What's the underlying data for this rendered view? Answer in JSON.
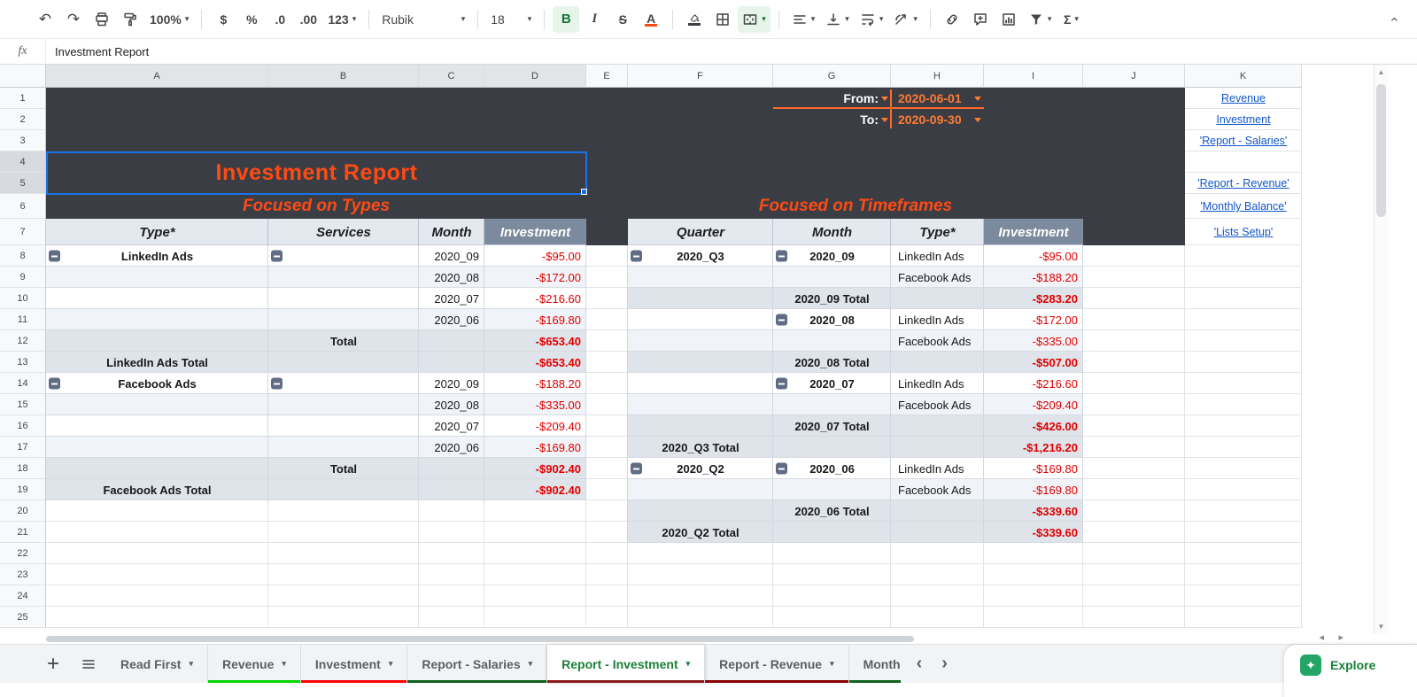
{
  "formula_bar": {
    "fx_label": "fx",
    "value": "Investment Report"
  },
  "toolbar": {
    "zoom": "100%",
    "font": "Rubik",
    "font_size": "18",
    "currency": "$",
    "percent": "%",
    "decimal_decrease": ".0",
    "decimal_increase": ".00",
    "number_format": "123",
    "bold": "B",
    "italic": "I",
    "strikethrough": "S",
    "text_color": "A",
    "functions": "Σ"
  },
  "icons": {
    "undo": "↶",
    "redo": "↷",
    "dropdown": "▾",
    "plus": "+",
    "prev": "‹",
    "next": "›",
    "explore_star": "✦",
    "scroll_up": "▲",
    "scroll_down": "▼",
    "scroll_left": "◂",
    "scroll_right": "▸"
  },
  "grid": {
    "column_letters": [
      "A",
      "B",
      "C",
      "D",
      "E",
      "F",
      "G",
      "H",
      "I",
      "J",
      "K"
    ],
    "row_numbers": [
      "1",
      "2",
      "3",
      "4",
      "5",
      "6",
      "7",
      "8",
      "9",
      "10",
      "11",
      "12",
      "13",
      "14",
      "15",
      "16",
      "17",
      "18",
      "19",
      "20",
      "21",
      "22",
      "23",
      "24",
      "25"
    ]
  },
  "filters": {
    "from_label": "From:",
    "from_value": "2020-06-01",
    "to_label": "To:",
    "to_value": "2020-09-30"
  },
  "title": "Investment Report",
  "left_table": {
    "heading": "Focused on Types",
    "columns": [
      "Type*",
      "Services",
      "Month",
      "Investment"
    ],
    "rows": [
      {
        "r": 8,
        "bg": "plain",
        "cells": [
          {
            "col": 0,
            "t": "LinkedIn Ads",
            "cls": "c b",
            "btn": true
          },
          {
            "col": 1,
            "t": "",
            "cls": "",
            "btn": true
          },
          {
            "col": 2,
            "t": "2020_09",
            "cls": "r"
          },
          {
            "col": 3,
            "t": "-$95.00",
            "cls": "r red"
          }
        ]
      },
      {
        "r": 9,
        "bg": "band",
        "cells": [
          {
            "col": 2,
            "t": "2020_08",
            "cls": "r"
          },
          {
            "col": 3,
            "t": "-$172.00",
            "cls": "r red"
          }
        ]
      },
      {
        "r": 10,
        "bg": "plain",
        "cells": [
          {
            "col": 2,
            "t": "2020_07",
            "cls": "r"
          },
          {
            "col": 3,
            "t": "-$216.60",
            "cls": "r red"
          }
        ]
      },
      {
        "r": 11,
        "bg": "band",
        "cells": [
          {
            "col": 2,
            "t": "2020_06",
            "cls": "r"
          },
          {
            "col": 3,
            "t": "-$169.80",
            "cls": "r red"
          }
        ]
      },
      {
        "r": 12,
        "bg": "total",
        "cells": [
          {
            "col": 1,
            "t": "Total",
            "cls": "c b"
          },
          {
            "col": 3,
            "t": "-$653.40",
            "cls": "r red b"
          }
        ]
      },
      {
        "r": 13,
        "bg": "total",
        "cells": [
          {
            "col": 0,
            "t": "LinkedIn Ads Total",
            "cls": "c b"
          },
          {
            "col": 3,
            "t": "-$653.40",
            "cls": "r red b"
          }
        ]
      },
      {
        "r": 14,
        "bg": "plain",
        "cells": [
          {
            "col": 0,
            "t": "Facebook Ads",
            "cls": "c b",
            "btn": true
          },
          {
            "col": 1,
            "t": "",
            "cls": "",
            "btn": true
          },
          {
            "col": 2,
            "t": "2020_09",
            "cls": "r"
          },
          {
            "col": 3,
            "t": "-$188.20",
            "cls": "r red"
          }
        ]
      },
      {
        "r": 15,
        "bg": "band",
        "cells": [
          {
            "col": 2,
            "t": "2020_08",
            "cls": "r"
          },
          {
            "col": 3,
            "t": "-$335.00",
            "cls": "r red"
          }
        ]
      },
      {
        "r": 16,
        "bg": "plain",
        "cells": [
          {
            "col": 2,
            "t": "2020_07",
            "cls": "r"
          },
          {
            "col": 3,
            "t": "-$209.40",
            "cls": "r red"
          }
        ]
      },
      {
        "r": 17,
        "bg": "band",
        "cells": [
          {
            "col": 2,
            "t": "2020_06",
            "cls": "r"
          },
          {
            "col": 3,
            "t": "-$169.80",
            "cls": "r red"
          }
        ]
      },
      {
        "r": 18,
        "bg": "total",
        "cells": [
          {
            "col": 1,
            "t": "Total",
            "cls": "c b"
          },
          {
            "col": 3,
            "t": "-$902.40",
            "cls": "r red b"
          }
        ]
      },
      {
        "r": 19,
        "bg": "total",
        "cells": [
          {
            "col": 0,
            "t": "Facebook Ads Total",
            "cls": "c b"
          },
          {
            "col": 3,
            "t": "-$902.40",
            "cls": "r red b"
          }
        ]
      }
    ]
  },
  "right_table": {
    "heading": "Focused on Timeframes",
    "columns": [
      "Quarter",
      "Month",
      "Type*",
      "Investment"
    ],
    "rows": [
      {
        "r": 8,
        "bg": "plain",
        "cells": [
          {
            "col": 0,
            "t": "2020_Q3",
            "cls": "c b",
            "btn": true
          },
          {
            "col": 1,
            "t": "2020_09",
            "cls": "c b",
            "btn": true
          },
          {
            "col": 2,
            "t": "LinkedIn Ads",
            "cls": "l"
          },
          {
            "col": 3,
            "t": "-$95.00",
            "cls": "r red"
          }
        ]
      },
      {
        "r": 9,
        "bg": "band",
        "cells": [
          {
            "col": 2,
            "t": "Facebook Ads",
            "cls": "l"
          },
          {
            "col": 3,
            "t": "-$188.20",
            "cls": "r red"
          }
        ]
      },
      {
        "r": 10,
        "bg": "total",
        "cells": [
          {
            "col": 1,
            "t": "2020_09 Total",
            "cls": "c b"
          },
          {
            "col": 3,
            "t": "-$283.20",
            "cls": "r red b"
          }
        ]
      },
      {
        "r": 11,
        "bg": "plain",
        "cells": [
          {
            "col": 1,
            "t": "2020_08",
            "cls": "c b",
            "btn": true
          },
          {
            "col": 2,
            "t": "LinkedIn Ads",
            "cls": "l"
          },
          {
            "col": 3,
            "t": "-$172.00",
            "cls": "r red"
          }
        ]
      },
      {
        "r": 12,
        "bg": "band",
        "cells": [
          {
            "col": 2,
            "t": "Facebook Ads",
            "cls": "l"
          },
          {
            "col": 3,
            "t": "-$335.00",
            "cls": "r red"
          }
        ]
      },
      {
        "r": 13,
        "bg": "total",
        "cells": [
          {
            "col": 1,
            "t": "2020_08 Total",
            "cls": "c b"
          },
          {
            "col": 3,
            "t": "-$507.00",
            "cls": "r red b"
          }
        ]
      },
      {
        "r": 14,
        "bg": "plain",
        "cells": [
          {
            "col": 1,
            "t": "2020_07",
            "cls": "c b",
            "btn": true
          },
          {
            "col": 2,
            "t": "LinkedIn Ads",
            "cls": "l"
          },
          {
            "col": 3,
            "t": "-$216.60",
            "cls": "r red"
          }
        ]
      },
      {
        "r": 15,
        "bg": "band",
        "cells": [
          {
            "col": 2,
            "t": "Facebook Ads",
            "cls": "l"
          },
          {
            "col": 3,
            "t": "-$209.40",
            "cls": "r red"
          }
        ]
      },
      {
        "r": 16,
        "bg": "total",
        "cells": [
          {
            "col": 1,
            "t": "2020_07 Total",
            "cls": "c b"
          },
          {
            "col": 3,
            "t": "-$426.00",
            "cls": "r red b"
          }
        ]
      },
      {
        "r": 17,
        "bg": "total",
        "cells": [
          {
            "col": 0,
            "t": "2020_Q3 Total",
            "cls": "c b"
          },
          {
            "col": 3,
            "t": "-$1,216.20",
            "cls": "r red b"
          }
        ]
      },
      {
        "r": 18,
        "bg": "plain",
        "cells": [
          {
            "col": 0,
            "t": "2020_Q2",
            "cls": "c b",
            "btn": true
          },
          {
            "col": 1,
            "t": "2020_06",
            "cls": "c b",
            "btn": true
          },
          {
            "col": 2,
            "t": "LinkedIn Ads",
            "cls": "l"
          },
          {
            "col": 3,
            "t": "-$169.80",
            "cls": "r red"
          }
        ]
      },
      {
        "r": 19,
        "bg": "band",
        "cells": [
          {
            "col": 2,
            "t": "Facebook Ads",
            "cls": "l"
          },
          {
            "col": 3,
            "t": "-$169.80",
            "cls": "r red"
          }
        ]
      },
      {
        "r": 20,
        "bg": "total",
        "cells": [
          {
            "col": 1,
            "t": "2020_06 Total",
            "cls": "c b"
          },
          {
            "col": 3,
            "t": "-$339.60",
            "cls": "r red b"
          }
        ]
      },
      {
        "r": 21,
        "bg": "total",
        "cells": [
          {
            "col": 0,
            "t": "2020_Q2 Total",
            "cls": "c b"
          },
          {
            "col": 3,
            "t": "-$339.60",
            "cls": "r red b"
          }
        ]
      }
    ]
  },
  "nav_links": [
    {
      "row": 1,
      "text": "Revenue"
    },
    {
      "row": 2,
      "text": "Investment"
    },
    {
      "row": 3,
      "text": "'Report - Salaries'"
    },
    {
      "row": 5,
      "text": "'Report - Revenue'"
    },
    {
      "row": 6,
      "text": "'Monthly Balance'"
    },
    {
      "row": 7,
      "text": "'Lists Setup'"
    }
  ],
  "sheet_tabs": {
    "tabs": [
      {
        "label": "Read First",
        "color": "",
        "active": false,
        "truncated": false
      },
      {
        "label": "Revenue",
        "color": "#00d400",
        "active": false,
        "truncated": false
      },
      {
        "label": "Investment",
        "color": "#ff0000",
        "active": false,
        "truncated": false
      },
      {
        "label": "Report - Salaries",
        "color": "#11601c",
        "active": false,
        "truncated": false
      },
      {
        "label": "Report - Investment",
        "color": "#8b1a1a",
        "active": true,
        "truncated": false
      },
      {
        "label": "Report - Revenue",
        "color": "#8b0000",
        "active": false,
        "truncated": false
      },
      {
        "label": "Month",
        "color": "#11601c",
        "active": false,
        "truncated": true
      }
    ],
    "explore_label": "Explore"
  },
  "colors": {
    "accent_orange": "#ff4a14",
    "negative_red": "#e00000",
    "dark_background": "#3a3e44",
    "investment_header": "#7c8a9e",
    "link_blue": "#1155cc",
    "selection_blue": "#1a73e8",
    "active_tab_green": "#188038"
  }
}
